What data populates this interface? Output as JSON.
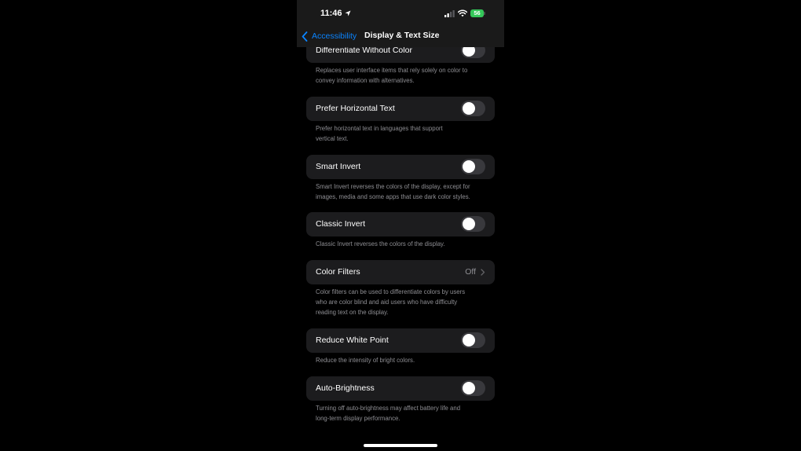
{
  "status_bar": {
    "time": "11:46",
    "battery": "56"
  },
  "nav": {
    "back_label": "Accessibility",
    "title": "Display & Text Size"
  },
  "settings": [
    {
      "label": "Differentiate Without Color",
      "type": "toggle",
      "on": false,
      "footer": [
        "Replaces user interface items that rely solely on color to",
        "convey information with alternatives."
      ]
    },
    {
      "label": "Prefer Horizontal Text",
      "type": "toggle",
      "on": false,
      "footer": [
        "Prefer horizontal text in languages that support",
        "vertical text."
      ]
    },
    {
      "label": "Smart Invert",
      "type": "toggle",
      "on": false,
      "footer": [
        "Smart Invert reverses the colors of the display, except for",
        "images, media and some apps that use dark color styles."
      ]
    },
    {
      "label": "Classic Invert",
      "type": "toggle",
      "on": false,
      "footer": [
        "Classic Invert reverses the colors of the display."
      ]
    },
    {
      "label": "Color Filters",
      "type": "link",
      "value": "Off",
      "footer": [
        "Color filters can be used to differentiate colors by users",
        "who are color blind and aid users who have difficulty",
        "reading text on the display."
      ]
    },
    {
      "label": "Reduce White Point",
      "type": "toggle",
      "on": false,
      "footer": [
        "Reduce the intensity of bright colors."
      ]
    },
    {
      "label": "Auto-Brightness",
      "type": "toggle",
      "on": false,
      "footer": [
        "Turning off auto-brightness may affect battery life and",
        "long-term display performance."
      ]
    }
  ]
}
